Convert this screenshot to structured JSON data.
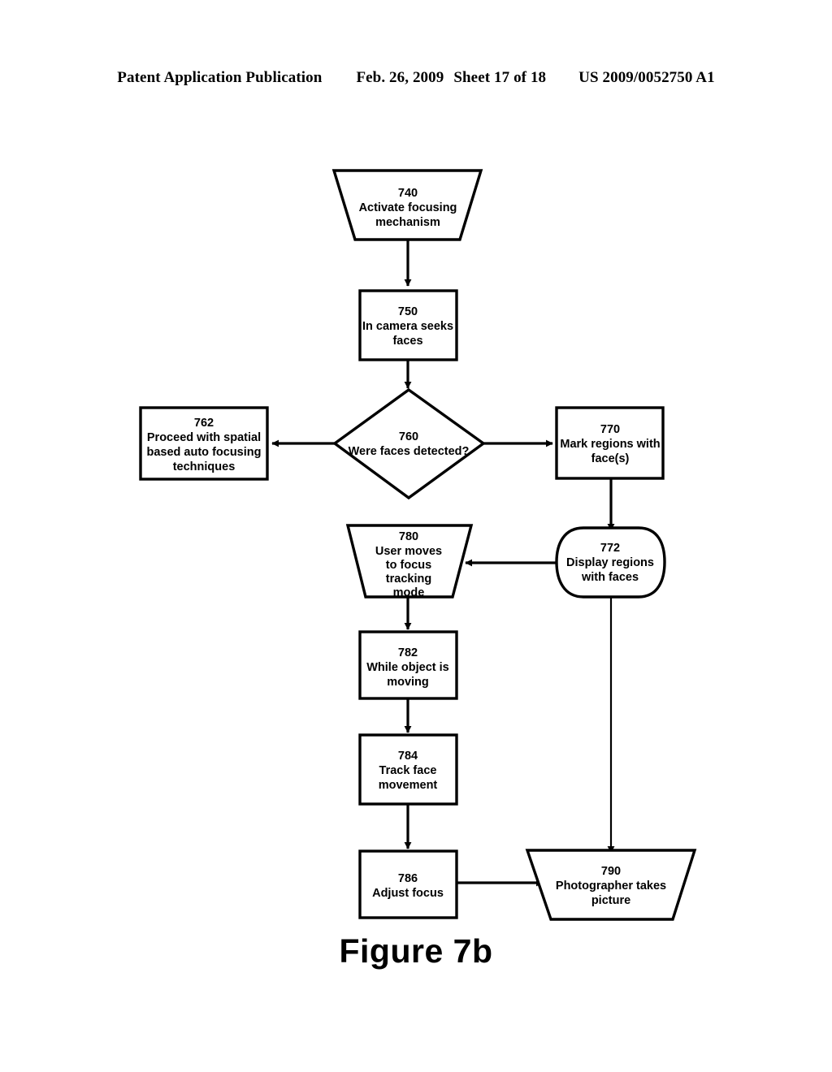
{
  "header": {
    "publication": "Patent Application Publication",
    "date": "Feb. 26, 2009",
    "sheet": "Sheet 17 of 18",
    "patent_number": "US 2009/0052750 A1"
  },
  "figure": {
    "caption": "Figure 7b"
  },
  "flowchart": {
    "nodes": [
      {
        "id": "740",
        "shape": "trapezoid-down",
        "number": "740",
        "lines": [
          "740",
          "Activate focusing",
          "mechanism"
        ]
      },
      {
        "id": "750",
        "shape": "rectangle",
        "number": "750",
        "lines": [
          "750",
          "In camera seeks",
          "faces"
        ]
      },
      {
        "id": "760",
        "shape": "diamond",
        "number": "760",
        "lines": [
          "760",
          "Were faces detected?"
        ]
      },
      {
        "id": "762",
        "shape": "rectangle",
        "number": "762",
        "lines": [
          "762",
          "Proceed with spatial",
          "based auto focusing",
          "techniques"
        ]
      },
      {
        "id": "770",
        "shape": "rectangle",
        "number": "770",
        "lines": [
          "770",
          "Mark regions with",
          "face(s)"
        ]
      },
      {
        "id": "772",
        "shape": "oval",
        "number": "772",
        "lines": [
          "772",
          "Display regions",
          "with faces"
        ]
      },
      {
        "id": "780",
        "shape": "trapezoid-down",
        "number": "780",
        "lines": [
          "780",
          "User moves",
          "to focus",
          "tracking",
          "mode"
        ]
      },
      {
        "id": "782",
        "shape": "rectangle",
        "number": "782",
        "lines": [
          "782",
          "While object is",
          "moving"
        ]
      },
      {
        "id": "784",
        "shape": "rectangle",
        "number": "784",
        "lines": [
          "784",
          "Track face",
          "movement"
        ]
      },
      {
        "id": "786",
        "shape": "rectangle",
        "number": "786",
        "lines": [
          "786",
          "Adjust focus"
        ]
      },
      {
        "id": "790",
        "shape": "trapezoid-down",
        "number": "790",
        "lines": [
          "790",
          "Photographer takes",
          "picture"
        ]
      }
    ],
    "edges": [
      {
        "from": "740",
        "to": "750",
        "direction": "down"
      },
      {
        "from": "750",
        "to": "760",
        "direction": "down"
      },
      {
        "from": "760",
        "to": "762",
        "direction": "left"
      },
      {
        "from": "760",
        "to": "770",
        "direction": "right"
      },
      {
        "from": "770",
        "to": "772",
        "direction": "down"
      },
      {
        "from": "772",
        "to": "780",
        "direction": "left"
      },
      {
        "from": "772",
        "to": "790",
        "direction": "down"
      },
      {
        "from": "780",
        "to": "782",
        "direction": "down"
      },
      {
        "from": "782",
        "to": "784",
        "direction": "down"
      },
      {
        "from": "784",
        "to": "786",
        "direction": "down"
      },
      {
        "from": "786",
        "to": "790",
        "direction": "right"
      }
    ]
  },
  "colors": {
    "ink": "#000000",
    "paper": "#ffffff"
  }
}
